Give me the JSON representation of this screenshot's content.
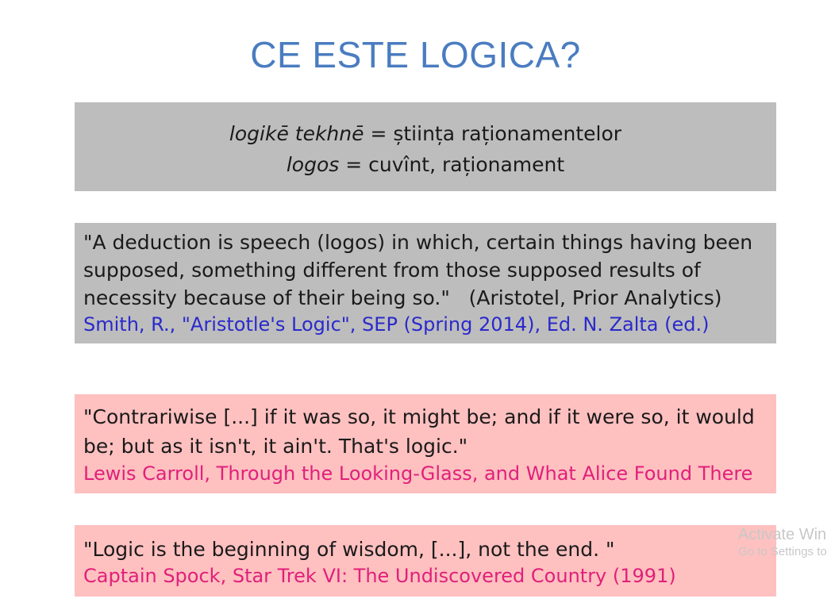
{
  "title": "CE ESTE LOGICA?",
  "etymology": {
    "line1_term": "logikē tekhnē",
    "line1_eq": " = ",
    "line1_def": "știința raționamentelor",
    "line2_term": "logos",
    "line2_eq": " = ",
    "line2_def": "cuvînt, raționament"
  },
  "quotes": [
    {
      "text": "\"A deduction is speech (logos) in which, certain things having been supposed, something different from those supposed results of necessity because of their being so.\"   (Aristotel, Prior Analytics)",
      "source": "Smith, R., \"Aristotle's Logic\", SEP (Spring 2014), Ed. N. Zalta (ed.)"
    },
    {
      "text": "\"Contrariwise [...] if it was so, it might be; and if it were so, it would be; but as it isn't, it ain't. That's logic.\"",
      "source": "Lewis Carroll, Through the Looking-Glass, and What Alice Found There"
    },
    {
      "text": "\"Logic is the beginning of wisdom, [...], not the end. \"",
      "source": "Captain Spock, Star Trek VI: The Undiscovered Country (1991)"
    }
  ],
  "watermark": {
    "line1": "Activate Win",
    "line2": "Go to Settings to"
  },
  "colors": {
    "title": "#4a7cc0",
    "gray_box": "#bdbdbd",
    "pink_box": "#ffc0c0",
    "source_blue": "#2a2acc",
    "source_pink": "#e0207a"
  }
}
